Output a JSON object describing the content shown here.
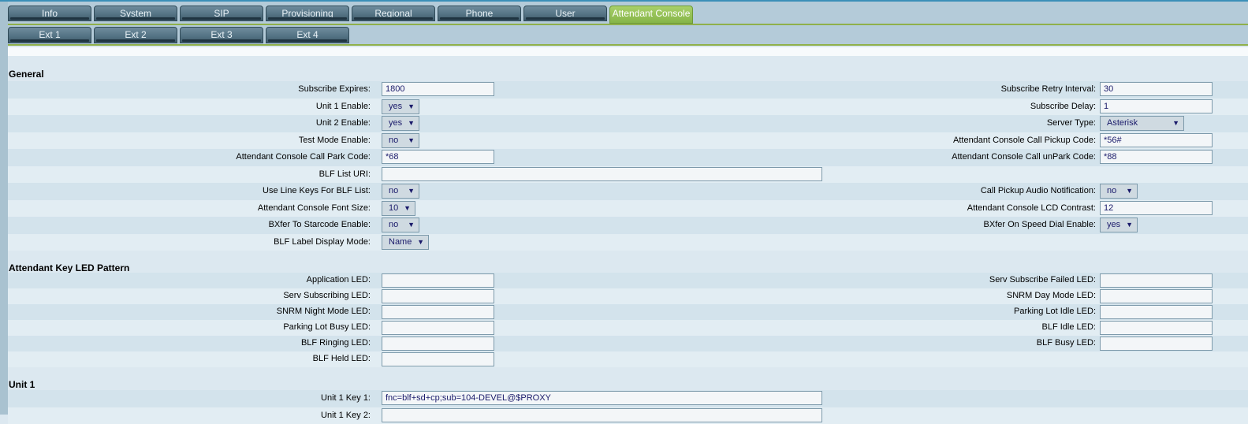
{
  "tabs_main": [
    {
      "label": "Info"
    },
    {
      "label": "System"
    },
    {
      "label": "SIP"
    },
    {
      "label": "Provisioning"
    },
    {
      "label": "Regional"
    },
    {
      "label": "Phone"
    },
    {
      "label": "User"
    },
    {
      "label": "Attendant Console",
      "active": true
    }
  ],
  "tabs_ext": [
    {
      "label": "Ext 1"
    },
    {
      "label": "Ext 2"
    },
    {
      "label": "Ext 3"
    },
    {
      "label": "Ext 4"
    }
  ],
  "colors": {
    "active_tab": "#8fbf55",
    "tab": "#557485",
    "background": "#dce8f0"
  },
  "general": {
    "title": "General",
    "subscribe_expires": {
      "label": "Subscribe Expires:",
      "value": "1800"
    },
    "subscribe_retry_interval": {
      "label": "Subscribe Retry Interval:",
      "value": "30"
    },
    "unit1_enable": {
      "label": "Unit 1 Enable:",
      "value": "yes"
    },
    "subscribe_delay": {
      "label": "Subscribe Delay:",
      "value": "1"
    },
    "unit2_enable": {
      "label": "Unit 2 Enable:",
      "value": "yes"
    },
    "server_type": {
      "label": "Server Type:",
      "value": "Asterisk"
    },
    "test_mode_enable": {
      "label": "Test Mode Enable:",
      "value": "no"
    },
    "call_pickup_code": {
      "label": "Attendant Console Call Pickup Code:",
      "value": "*56#"
    },
    "call_park_code": {
      "label": "Attendant Console Call Park Code:",
      "value": "*68"
    },
    "call_unpark_code": {
      "label": "Attendant Console Call unPark Code:",
      "value": "*88"
    },
    "blf_list_uri": {
      "label": "BLF List URI:",
      "value": ""
    },
    "use_line_keys": {
      "label": "Use Line Keys For BLF List:",
      "value": "no"
    },
    "call_pickup_audio": {
      "label": "Call Pickup Audio Notification:",
      "value": "no"
    },
    "font_size": {
      "label": "Attendant Console Font Size:",
      "value": "10"
    },
    "lcd_contrast": {
      "label": "Attendant Console LCD Contrast:",
      "value": "12"
    },
    "bxfer_starcode": {
      "label": "BXfer To Starcode Enable:",
      "value": "no"
    },
    "bxfer_speed_dial": {
      "label": "BXfer On Speed Dial Enable:",
      "value": "yes"
    },
    "blf_label_mode": {
      "label": "BLF Label Display Mode:",
      "value": "Name"
    }
  },
  "led": {
    "title": "Attendant Key LED Pattern",
    "application": {
      "label": "Application LED:",
      "value": ""
    },
    "serv_subscribe_failed": {
      "label": "Serv Subscribe Failed LED:",
      "value": ""
    },
    "serv_subscribing": {
      "label": "Serv Subscribing LED:",
      "value": ""
    },
    "snrm_day": {
      "label": "SNRM Day Mode LED:",
      "value": ""
    },
    "snrm_night": {
      "label": "SNRM Night Mode LED:",
      "value": ""
    },
    "parking_idle": {
      "label": "Parking Lot Idle LED:",
      "value": ""
    },
    "parking_busy": {
      "label": "Parking Lot Busy LED:",
      "value": ""
    },
    "blf_idle": {
      "label": "BLF Idle LED:",
      "value": ""
    },
    "blf_ringing": {
      "label": "BLF Ringing LED:",
      "value": ""
    },
    "blf_busy": {
      "label": "BLF Busy LED:",
      "value": ""
    },
    "blf_held": {
      "label": "BLF Held LED:",
      "value": ""
    }
  },
  "unit1": {
    "title": "Unit 1",
    "key1": {
      "label": "Unit 1 Key 1:",
      "value": "fnc=blf+sd+cp;sub=104-DEVEL@$PROXY"
    },
    "key2": {
      "label": "Unit 1 Key 2:",
      "value": ""
    }
  }
}
